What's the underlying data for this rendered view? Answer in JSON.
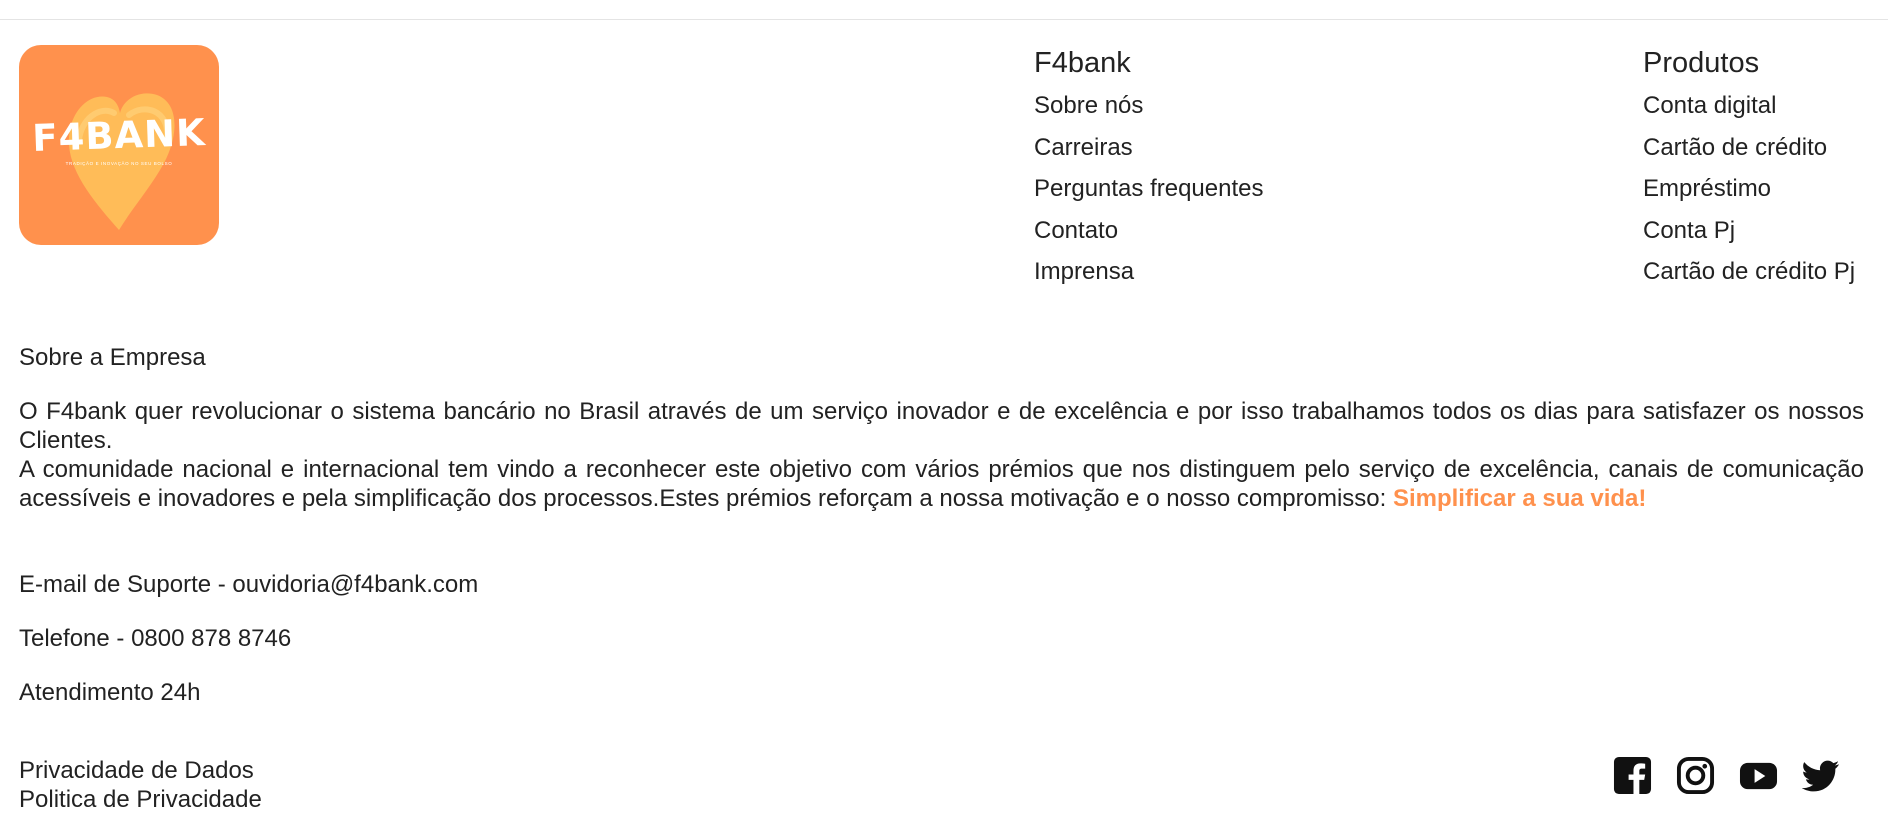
{
  "brand": {
    "logo_text": "F4BANK",
    "logo_tagline": "TRADIÇÃO E INOVAÇÃO NO SEU BOLSO",
    "logo_bg": "#ff914d",
    "accent": "#ff914d"
  },
  "nav": {
    "f4bank": {
      "title": "F4bank",
      "items": [
        "Sobre nós",
        "Carreiras",
        "Perguntas frequentes",
        "Contato",
        "Imprensa"
      ]
    },
    "produtos": {
      "title": "Produtos",
      "items": [
        "Conta digital",
        "Cartão de crédito",
        "Empréstimo",
        "Conta Pj",
        "Cartão de crédito Pj"
      ]
    }
  },
  "about": {
    "heading": "Sobre a Empresa",
    "paragraph1": "O F4bank quer revolucionar o sistema bancário no Brasil através de um serviço inovador e de excelência e por isso trabalhamos todos os dias para satisfazer os nossos Clientes.",
    "paragraph2": "A comunidade nacional e internacional tem vindo a reconhecer este objetivo com vários prémios que nos distinguem pelo serviço de excelência, canais de comunicação acessíveis e inovadores e pela simplificação dos processos.Estes prémios reforçam a nossa motivação e o nosso compromisso: ",
    "highlight": "Simplificar a sua vida!"
  },
  "contact": {
    "email": "E-mail de Suporte - ouvidoria@f4bank.com",
    "phone": "Telefone - 0800 878 8746",
    "hours": "Atendimento 24h"
  },
  "footer": {
    "privacy_data": "Privacidade de Dados",
    "privacy_policy": "Politica de Privacidade"
  },
  "socials": [
    "facebook-icon",
    "instagram-icon",
    "youtube-icon",
    "twitter-icon"
  ]
}
